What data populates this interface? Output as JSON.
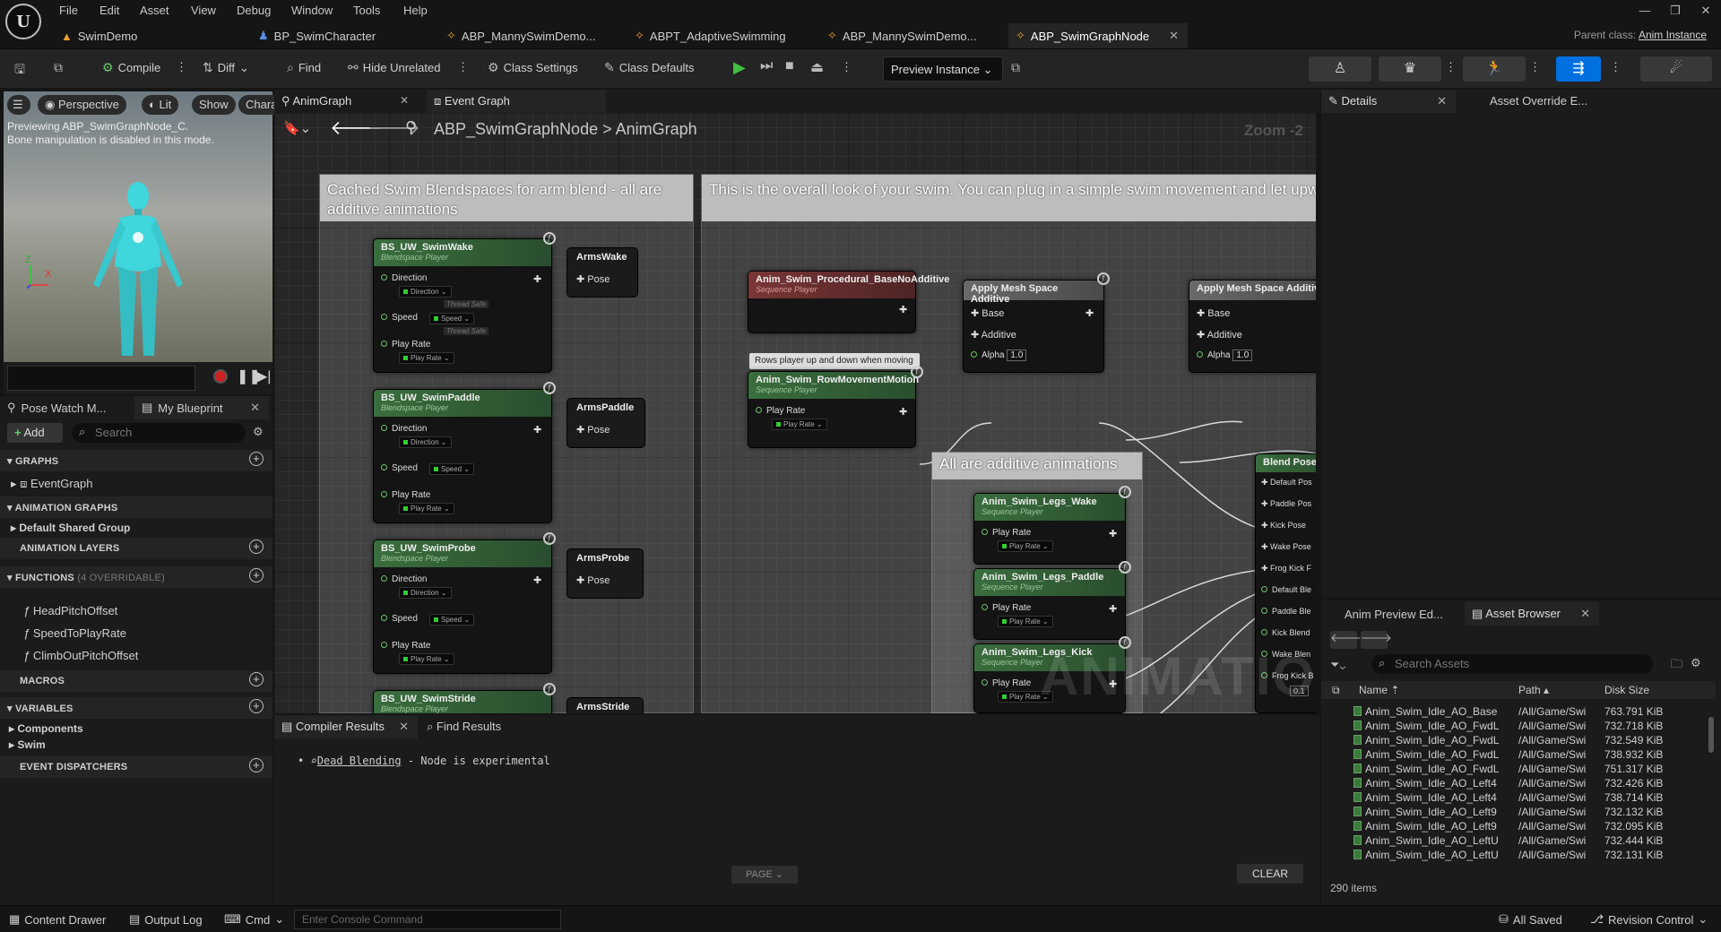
{
  "menu": [
    "File",
    "Edit",
    "Asset",
    "View",
    "Debug",
    "Window",
    "Tools",
    "Help"
  ],
  "window_controls": [
    "—",
    "❐",
    "✕"
  ],
  "doc_tabs": [
    {
      "label": "SwimDemo",
      "icon": "level-icon",
      "active": false
    },
    {
      "label": "BP_SwimCharacter",
      "icon": "blueprint-icon",
      "active": false
    },
    {
      "label": "ABP_MannySwimDemo...",
      "icon": "anim-blueprint-icon",
      "active": false
    },
    {
      "label": "ABPT_AdaptiveSwimming",
      "icon": "anim-blueprint-icon",
      "active": false
    },
    {
      "label": "ABP_MannySwimDemo...",
      "icon": "anim-blueprint-icon",
      "active": false
    },
    {
      "label": "ABP_SwimGraphNode",
      "icon": "anim-blueprint-icon",
      "active": true
    }
  ],
  "parent_class": {
    "label": "Parent class:",
    "value": "Anim Instance"
  },
  "toolbar": {
    "compile": "Compile",
    "diff": "Diff",
    "find": "Find",
    "hide_unrelated": "Hide Unrelated",
    "class_settings": "Class Settings",
    "class_defaults": "Class Defaults",
    "preview": "Preview Instance"
  },
  "viewport": {
    "perspective": "Perspective",
    "lit": "Lit",
    "show": "Show",
    "chara": "Chara",
    "msg1": "Previewing ABP_SwimGraphNode_C.",
    "msg2": "Bone manipulation is disabled in this mode.",
    "axis_z": "Z",
    "axis_x": "X"
  },
  "left": {
    "tab_pose_watch": "Pose Watch M...",
    "tab_blueprint": "My Blueprint",
    "add": "Add",
    "search_placeholder": "Search",
    "graphs": "GRAPHS",
    "event_graph": "EventGraph",
    "anim_graphs": "ANIMATION GRAPHS",
    "default_group": "Default Shared Group",
    "anim_layers": "ANIMATION LAYERS",
    "functions": "FUNCTIONS",
    "functions_count": "(4 OVERRIDABLE)",
    "func_items": [
      "HeadPitchOffset",
      "SpeedToPlayRate",
      "ClimbOutPitchOffset"
    ],
    "macros": "MACROS",
    "variables": "VARIABLES",
    "components": "Components",
    "swim": "Swim",
    "event_dispatchers": "EVENT DISPATCHERS"
  },
  "graph": {
    "tab_anim": "AnimGraph",
    "tab_event": "Event Graph",
    "crumb_root": "ABP_SwimGraphNode",
    "crumb_sep": ">",
    "crumb_leaf": "AnimGraph",
    "zoom": "Zoom -2",
    "comment1": "Cached Swim Blendspaces for arm blend - all are additive animations",
    "comment2": "This is the overall look of your swim. You can plug in a simple swim movement and let upwards, since the procedural part handles orientation in the water",
    "comment3": "All are additive animations",
    "watermark": "ANIMATION",
    "bs_subtitle": "Blendspace Player",
    "seq_subtitle": "Sequence Player",
    "pin_direction": "Direction",
    "pin_speed": "Speed",
    "pin_playrate": "Play Rate",
    "dd_direction": "Direction",
    "dd_speed": "Speed",
    "dd_playrate": "Play Rate",
    "thread_safe": "Thread Safe",
    "bs_nodes": [
      "BS_UW_SwimWake",
      "BS_UW_SwimPaddle",
      "BS_UW_SwimProbe",
      "BS_UW_SwimStride"
    ],
    "pose_nodes": [
      "ArmsWake",
      "ArmsPaddle",
      "ArmsProbe",
      "ArmsStride"
    ],
    "pose_label": "Pose",
    "proc_node": "Anim_Swim_Procedural_BaseNoAdditive",
    "row_comment": "Rows player up and down when moving",
    "row_node": "Anim_Swim_RowMovementMotion",
    "apply_node": "Apply Mesh Space Additive",
    "pin_base": "Base",
    "pin_additive": "Additive",
    "pin_alpha": "Alpha",
    "alpha_val": "1.0",
    "legs_nodes": [
      "Anim_Swim_Legs_Wake",
      "Anim_Swim_Legs_Paddle",
      "Anim_Swim_Legs_Kick"
    ],
    "blend_node": "Blend Poses (",
    "blend_pins": [
      "Default Pos",
      "Paddle Pos",
      "Kick Pose",
      "Wake Pose",
      "Frog Kick F",
      "Default Ble",
      "Paddle Ble",
      "Kick Blend",
      "Wake Blen",
      "Frog Kick B"
    ],
    "blend_val": "0.1"
  },
  "details": {
    "tab": "Details",
    "tab2": "Asset Override E..."
  },
  "asset_browser": {
    "tab_preview": "Anim Preview Ed...",
    "tab_browser": "Asset Browser",
    "search_placeholder": "Search Assets",
    "col_name": "Name",
    "col_path": "Path",
    "col_size": "Disk Size",
    "rows": [
      [
        "Anim_Swim_Idle_AO_Base",
        "/All/Game/Swi",
        "763.791 KiB"
      ],
      [
        "Anim_Swim_Idle_AO_FwdL",
        "/All/Game/Swi",
        "732.718 KiB"
      ],
      [
        "Anim_Swim_Idle_AO_FwdL",
        "/All/Game/Swi",
        "732.549 KiB"
      ],
      [
        "Anim_Swim_Idle_AO_FwdL",
        "/All/Game/Swi",
        "738.932 KiB"
      ],
      [
        "Anim_Swim_Idle_AO_FwdL",
        "/All/Game/Swi",
        "751.317 KiB"
      ],
      [
        "Anim_Swim_Idle_AO_Left4",
        "/All/Game/Swi",
        "732.426 KiB"
      ],
      [
        "Anim_Swim_Idle_AO_Left4",
        "/All/Game/Swi",
        "738.714 KiB"
      ],
      [
        "Anim_Swim_Idle_AO_Left9",
        "/All/Game/Swi",
        "732.132 KiB"
      ],
      [
        "Anim_Swim_Idle_AO_Left9",
        "/All/Game/Swi",
        "732.095 KiB"
      ],
      [
        "Anim_Swim_Idle_AO_LeftU",
        "/All/Game/Swi",
        "732.444 KiB"
      ],
      [
        "Anim_Swim_Idle_AO_LeftU",
        "/All/Game/Swi",
        "732.131 KiB"
      ]
    ],
    "count": "290 items"
  },
  "compiler": {
    "tab_results": "Compiler Results",
    "tab_find": "Find Results",
    "link": "Dead Blending",
    "msg": "- Node is experimental",
    "page": "PAGE",
    "clear": "CLEAR"
  },
  "status": {
    "content_drawer": "Content Drawer",
    "output_log": "Output Log",
    "cmd": "Cmd",
    "console_placeholder": "Enter Console Command",
    "all_saved": "All Saved",
    "revision": "Revision Control"
  },
  "colors": {
    "accent": "#0070e0",
    "node_green": "#3a6e3e",
    "node_red": "#7a3636",
    "play_green": "#40c040"
  }
}
